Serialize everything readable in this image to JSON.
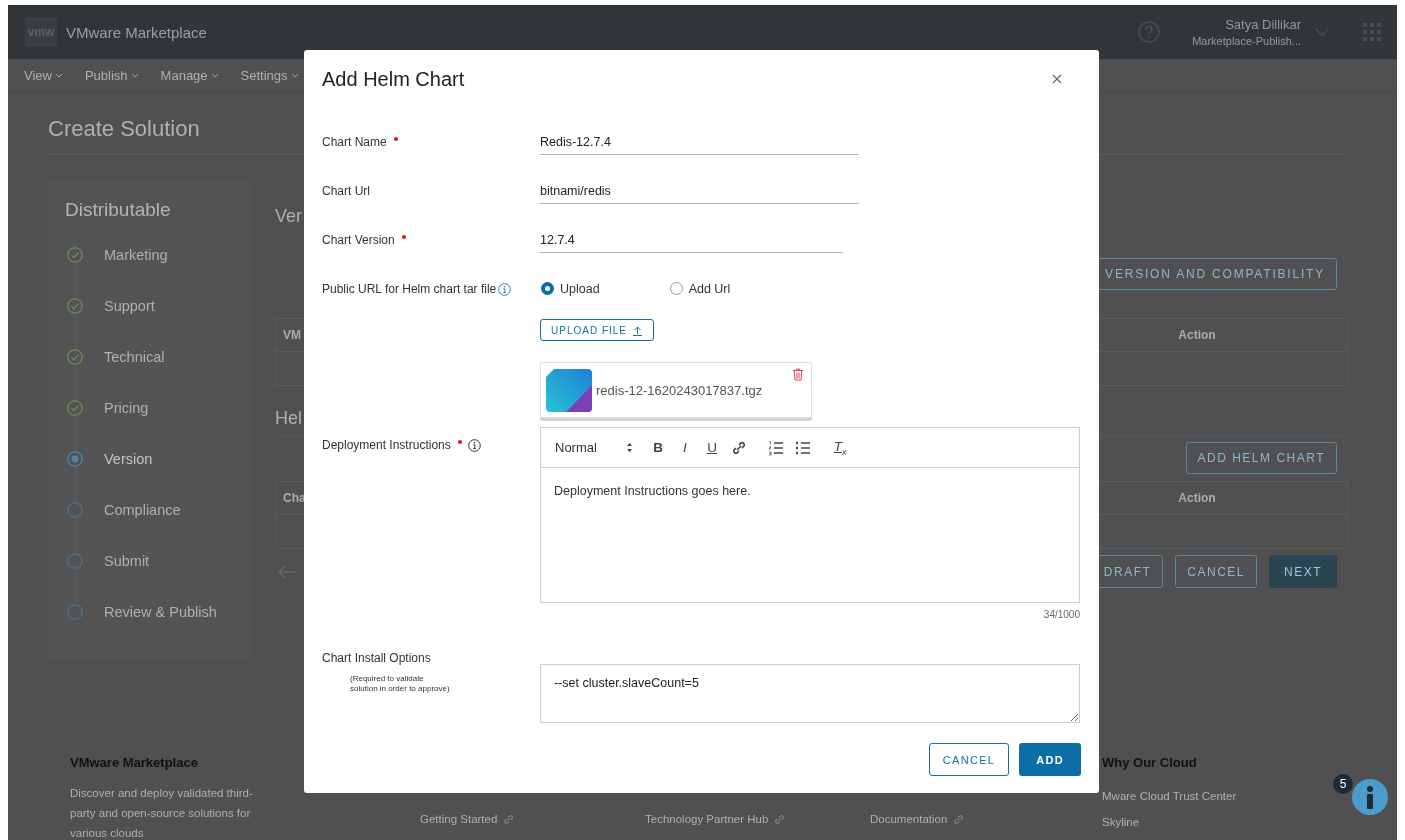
{
  "app_header": {
    "logo": "vmw",
    "title": "VMware Marketplace",
    "user_name": "Satya Dillikar",
    "user_role": "Marketplace-Publish..."
  },
  "nav_menu": [
    "View",
    "Publish",
    "Manage",
    "Settings"
  ],
  "page_title": "Create Solution",
  "steps": {
    "title": "Distributable",
    "items": [
      {
        "label": "Marketing",
        "done": true,
        "selected": false
      },
      {
        "label": "Support",
        "done": true,
        "selected": false
      },
      {
        "label": "Technical",
        "done": true,
        "selected": false
      },
      {
        "label": "Pricing",
        "done": true,
        "selected": false
      },
      {
        "label": "Version",
        "done": false,
        "selected": true
      },
      {
        "label": "Compliance",
        "done": false,
        "selected": false
      },
      {
        "label": "Submit",
        "done": false,
        "selected": false
      },
      {
        "label": "Review & Publish",
        "done": false,
        "selected": false
      }
    ]
  },
  "main": {
    "version_heading": "Ver",
    "add_version_button": "VERSION AND COMPATIBILITY",
    "version_table": {
      "columns": [
        "VM",
        "Action"
      ]
    },
    "helm_heading": "Hel",
    "add_helm_button": "ADD HELM CHART",
    "helm_table": {
      "columns": [
        "Cha",
        "Action"
      ]
    },
    "actions": [
      {
        "label": "DRAFT",
        "kind": "outline"
      },
      {
        "label": "CANCEL",
        "kind": "outline"
      },
      {
        "label": "NEXT",
        "kind": "primary"
      }
    ]
  },
  "footer": {
    "about_title": "VMware Marketplace",
    "about_text": "Discover and deploy validated third-party and open-source solutions for various clouds",
    "links": [
      "Getting Started",
      "Technology Partner Hub",
      "Documentation"
    ],
    "why_title": "Why Our Cloud",
    "why_links": [
      "Mware Cloud Trust Center",
      "Skyline"
    ]
  },
  "help_badge": {
    "count": "5"
  },
  "dialog": {
    "title": "Add Helm Chart",
    "fields": [
      {
        "kind": "text",
        "label": "Chart Name",
        "required": true,
        "value": "Redis-12.7.4"
      },
      {
        "kind": "text",
        "label": "Chart Url",
        "required": false,
        "value": "bitnami/redis"
      },
      {
        "kind": "text",
        "label": "Chart Version",
        "required": true,
        "value": "12.7.4"
      },
      {
        "kind": "source",
        "label": "Public URL for Helm chart tar file",
        "required": false,
        "info": true,
        "options": [
          {
            "label": "Upload",
            "selected": true
          },
          {
            "label": "Add Url",
            "selected": false
          }
        ],
        "upload_button": "UPLOAD FILE",
        "file_name": "redis-12-1620243017837.tgz"
      },
      {
        "kind": "editor",
        "label": "Deployment Instructions",
        "required": true,
        "info": true,
        "format": "Normal",
        "tools": [
          {
            "kind": "bold",
            "glyph": "B"
          },
          {
            "kind": "italic",
            "glyph": "I"
          },
          {
            "kind": "underline",
            "glyph": "U"
          },
          {
            "kind": "link"
          },
          {
            "kind": "ordered"
          },
          {
            "kind": "bullet"
          },
          {
            "kind": "clear",
            "glyph": "T$_{x}$"
          }
        ],
        "value": "Deployment Instructions goes here.",
        "counter": "34/1000"
      },
      {
        "kind": "textarea",
        "label": "Chart Install Options",
        "required": false,
        "note": "(Required to validate solution in order to approve)",
        "value": "--set cluster.slaveCount=5"
      }
    ],
    "buttons": [
      {
        "label": "CANCEL",
        "kind": "secondary"
      },
      {
        "label": "ADD",
        "kind": "primary"
      }
    ]
  }
}
